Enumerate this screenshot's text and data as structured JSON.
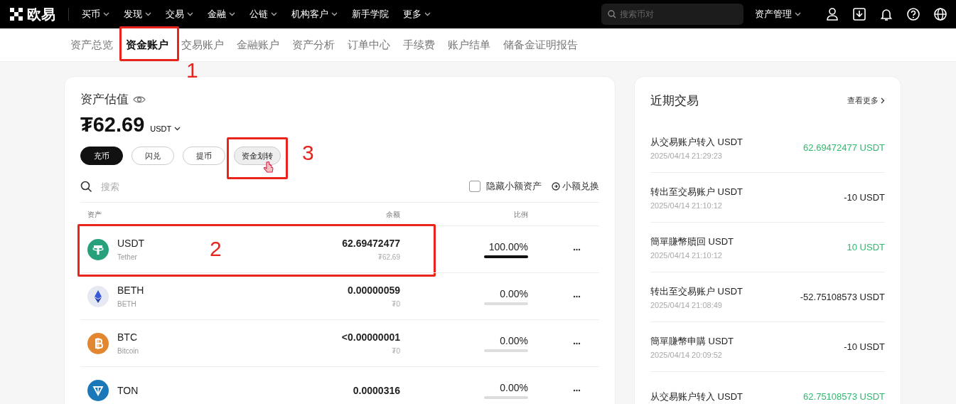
{
  "topbar": {
    "logo": "欧易",
    "nav": [
      {
        "label": "买币",
        "dropdown": true
      },
      {
        "label": "发现",
        "dropdown": true
      },
      {
        "label": "交易",
        "dropdown": true
      },
      {
        "label": "金融",
        "dropdown": true
      },
      {
        "label": "公链",
        "dropdown": true
      },
      {
        "label": "机构客户",
        "dropdown": true
      },
      {
        "label": "新手学院",
        "dropdown": false
      },
      {
        "label": "更多",
        "dropdown": true
      }
    ],
    "search": {
      "placeholder": "搜索币对"
    },
    "asset_menu": "资产管理"
  },
  "tabs": [
    {
      "label": "资产总览",
      "selected": false
    },
    {
      "label": "资金账户",
      "selected": true,
      "annotation": "1"
    },
    {
      "label": "交易账户",
      "selected": false
    },
    {
      "label": "金融账户",
      "selected": false
    },
    {
      "label": "资产分析",
      "selected": false
    },
    {
      "label": "订单中心",
      "selected": false
    },
    {
      "label": "手续费",
      "selected": false
    },
    {
      "label": "账户结单",
      "selected": false
    },
    {
      "label": "储备金证明报告",
      "selected": false
    }
  ],
  "valuation": {
    "title": "资产估值",
    "amount": "₮62.69",
    "currency": "USDT",
    "actions": [
      {
        "label": "充币",
        "kind": "primary"
      },
      {
        "label": "闪兑",
        "kind": "outline"
      },
      {
        "label": "提币",
        "kind": "outline"
      },
      {
        "label": "资金划转",
        "kind": "soft",
        "annotation": "3"
      }
    ]
  },
  "filter": {
    "search_placeholder": "搜索",
    "hide_small": {
      "label": "隐藏小额资产",
      "checked": false
    },
    "convert_small": "小额兑换"
  },
  "table": {
    "columns": [
      "资产",
      "余额",
      "比例"
    ],
    "rows": [
      {
        "symbol": "USDT",
        "name": "Tether",
        "kind": "usdt",
        "color": "#26a17b",
        "balance": "62.69472477",
        "value": "₮62.69",
        "share": "100.00%",
        "level": 1,
        "annotation": "2"
      },
      {
        "symbol": "BETH",
        "name": "BETH",
        "kind": "eth",
        "color": "#e6e8f2",
        "balance": "0.00000059",
        "value": "₮0",
        "share": "0.00%",
        "level": 0
      },
      {
        "symbol": "BTC",
        "name": "Bitcoin",
        "kind": "btc",
        "color": "#e2862f",
        "balance": "<0.00000001",
        "value": "₮0",
        "share": "0.00%",
        "level": 0
      },
      {
        "symbol": "TON",
        "kind": "ton",
        "color": "#1a78b8",
        "balance": "0.0000316",
        "share": "0.00%",
        "level": 0
      }
    ]
  },
  "recent": {
    "title": "近期交易",
    "more": "查看更多",
    "items": [
      {
        "title": "从交易账户转入 USDT",
        "time": "2025/04/14 21:29:23",
        "amount": "62.69472477 USDT",
        "positive": true
      },
      {
        "title": "转出至交易账户 USDT",
        "time": "2025/04/14 21:10:12",
        "amount": "-10 USDT",
        "positive": false
      },
      {
        "title": "簡單賺幣贖回 USDT",
        "time": "2025/04/14 21:10:12",
        "amount": "10 USDT",
        "positive": true
      },
      {
        "title": "转出至交易账户 USDT",
        "time": "2025/04/14 21:08:49",
        "amount": "-52.75108573 USDT",
        "positive": false
      },
      {
        "title": "簡單賺幣申購 USDT",
        "time": "2025/04/14 20:09:52",
        "amount": "-10 USDT",
        "positive": false
      },
      {
        "title": "从交易账户转入 USDT",
        "amount": "62.75108573 USDT",
        "positive": true
      }
    ]
  }
}
